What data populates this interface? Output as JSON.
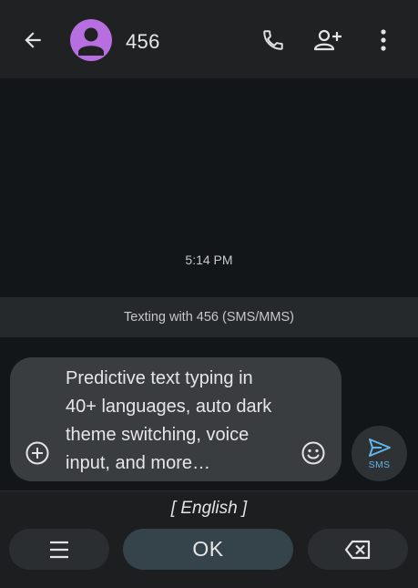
{
  "header": {
    "contact_name": "456",
    "icons": [
      "back-arrow-icon",
      "person-icon",
      "phone-icon",
      "add-person-icon",
      "more-vert-icon"
    ]
  },
  "conversation": {
    "timestamp": "5:14 PM",
    "texting_label": "Texting with 456 (SMS/MMS)"
  },
  "compose": {
    "text": "Predictive text typing in 40+ languages, auto dark theme switching, voice input, and more…",
    "send_label": "SMS"
  },
  "keyboard": {
    "language": "[ English ]",
    "ok_label": "OK"
  },
  "colors": {
    "avatar": "#b66ee0",
    "send_accent": "#62b6e9",
    "ok_key": "#34444a"
  }
}
